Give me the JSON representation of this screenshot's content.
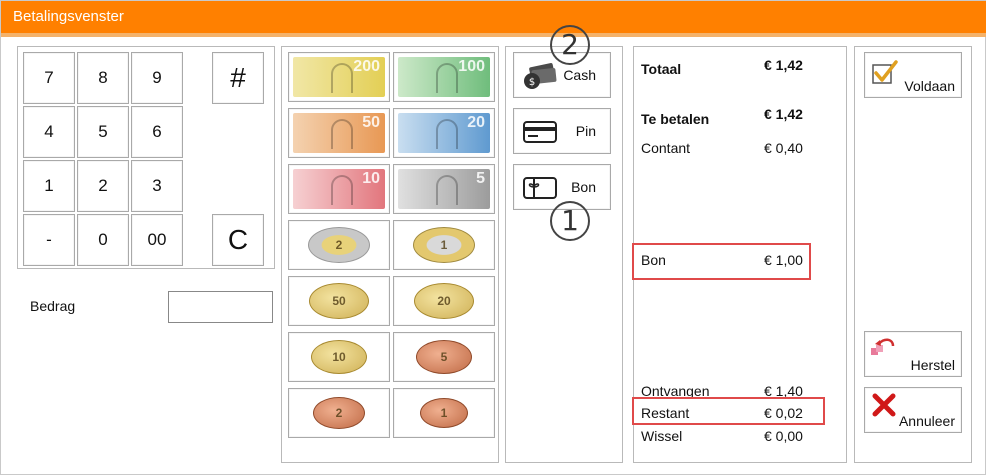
{
  "window": {
    "title": "Betalingsvenster"
  },
  "keypad": {
    "keys": [
      "7",
      "8",
      "9",
      "4",
      "5",
      "6",
      "1",
      "2",
      "3",
      "-",
      "0",
      "00"
    ],
    "hash": "#",
    "clear": "C"
  },
  "bedrag": {
    "label": "Bedrag",
    "value": ""
  },
  "money": {
    "bills": [
      {
        "value": "200",
        "color": "#e9d66b"
      },
      {
        "value": "100",
        "color": "#7cc48a"
      },
      {
        "value": "50",
        "color": "#e8a060"
      },
      {
        "value": "20",
        "color": "#6fa8d8"
      },
      {
        "value": "10",
        "color": "#e87a80"
      },
      {
        "value": "5",
        "color": "#a8a8a8"
      }
    ],
    "coins": [
      {
        "value": "2",
        "type": "bi-silver"
      },
      {
        "value": "1",
        "type": "bi-gold"
      },
      {
        "value": "50",
        "type": "gold"
      },
      {
        "value": "20",
        "type": "gold"
      },
      {
        "value": "10",
        "type": "gold"
      },
      {
        "value": "5",
        "type": "copper"
      },
      {
        "value": "2",
        "type": "copper"
      },
      {
        "value": "1",
        "type": "copper"
      }
    ]
  },
  "payment_methods": {
    "cash": "Cash",
    "pin": "Pin",
    "bon": "Bon"
  },
  "summary": {
    "totaal_label": "Totaal",
    "totaal_value": "€ 1,42",
    "te_betalen_label": "Te betalen",
    "te_betalen_value": "€ 1,42",
    "contant_label": "Contant",
    "contant_value": "€ 0,40",
    "bon_label": "Bon",
    "bon_value": "€ 1,00",
    "ontvangen_label": "Ontvangen",
    "ontvangen_value": "€ 1,40",
    "restant_label": "Restant",
    "restant_value": "€ 0,02",
    "wissel_label": "Wissel",
    "wissel_value": "€ 0,00"
  },
  "actions": {
    "voldaan": "Voldaan",
    "herstel": "Herstel",
    "annuleer": "Annuleer"
  },
  "annotations": [
    "2",
    "1"
  ],
  "colors": {
    "titlebar": "#ff8000",
    "highlight": "#e04a4a"
  }
}
